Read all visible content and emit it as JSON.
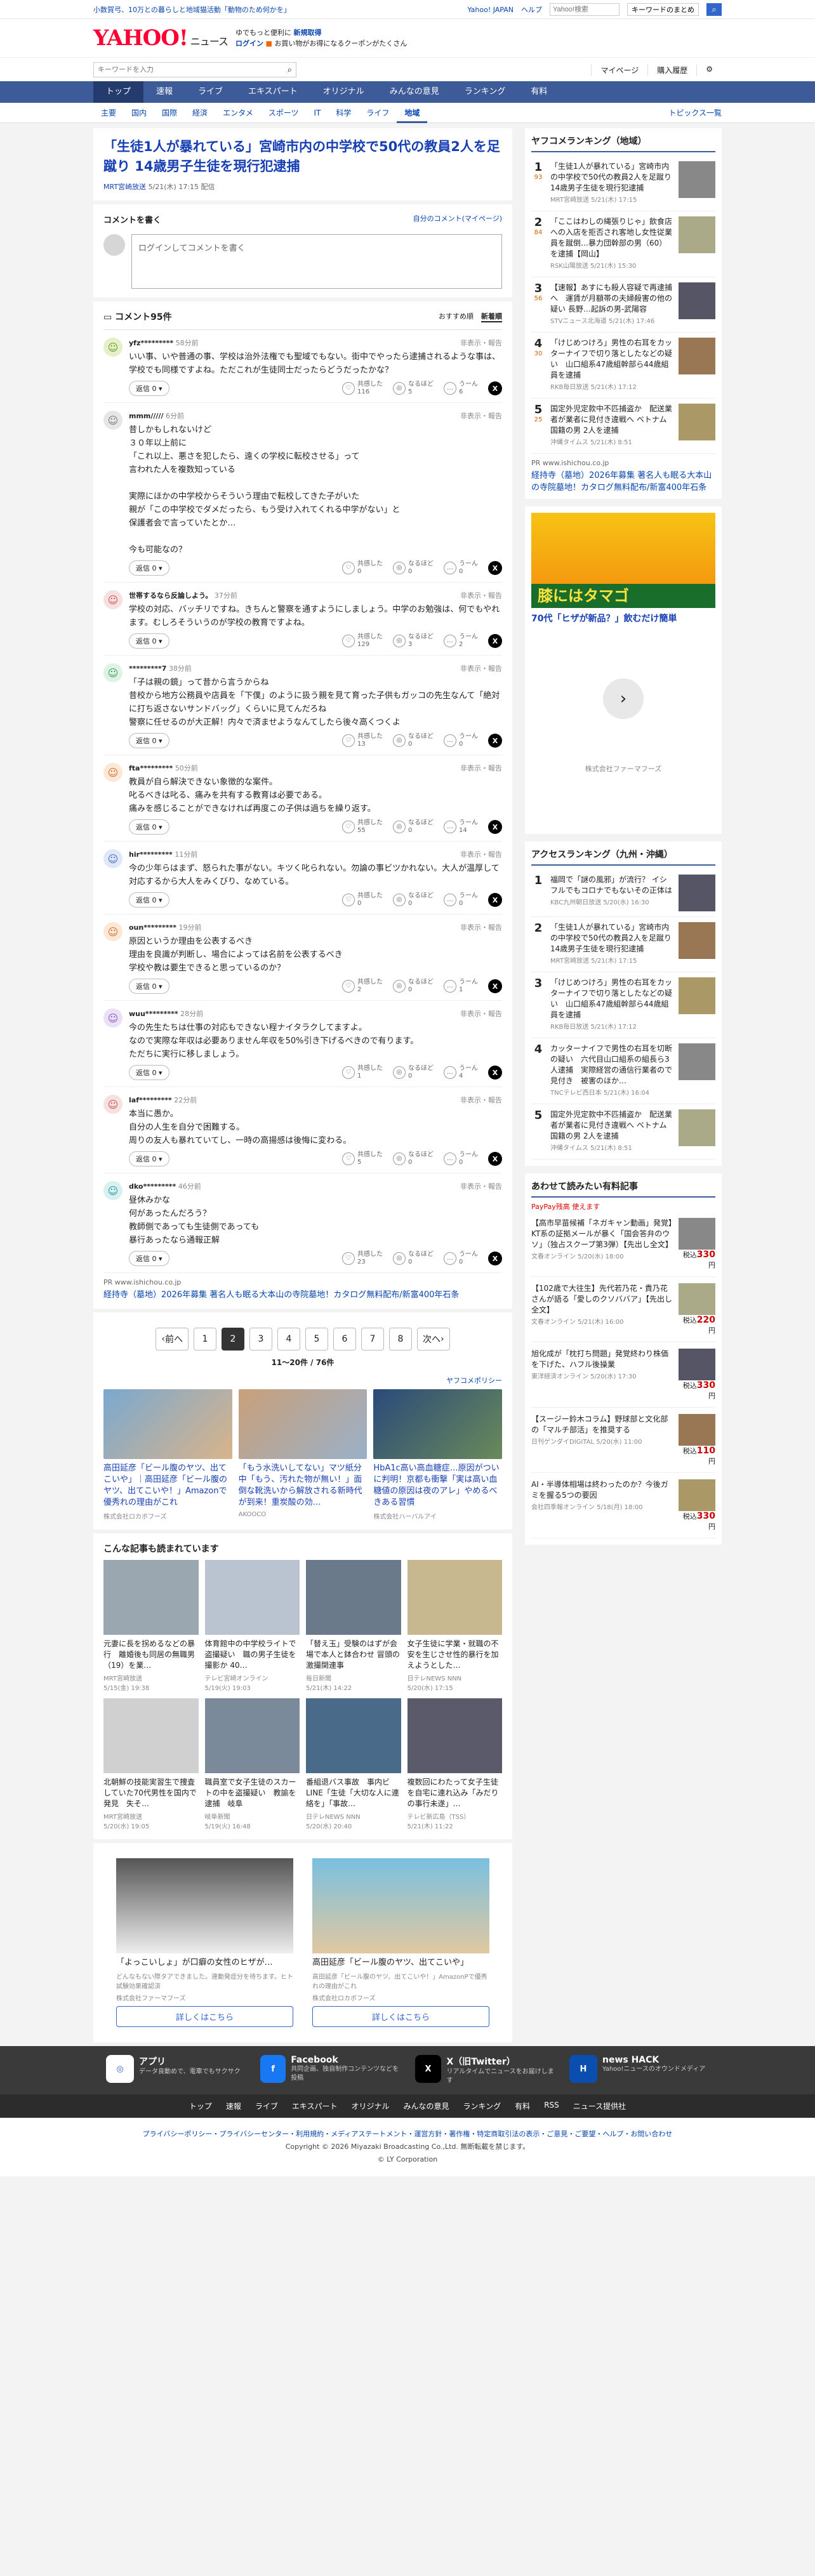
{
  "topbar": {
    "promo": "小数賀弓、10万との暮らしと地域猫活動「動物のため何かを」",
    "yj": "Yahoo! JAPAN",
    "help": "ヘルプ",
    "search_placeholder": "Yahoo!検索",
    "kw_label": "キーワードのまとめ"
  },
  "header": {
    "logo": "YAHOO!",
    "logo_sub": "JAPAN",
    "site": "ニュース",
    "line1a": "ゆでもっと便利に",
    "line1b": "新規取得",
    "line2a": "ログイン",
    "line2b": "お買い物がお得になるクーポンがたくさん"
  },
  "search": {
    "placeholder": "キーワードを入力",
    "mypage": "マイページ",
    "buy": "購入履歴"
  },
  "gnav": [
    "トップ",
    "速報",
    "ライブ",
    "エキスパート",
    "オリジナル",
    "みんなの意見",
    "ランキング",
    "有料"
  ],
  "subnav": [
    "主要",
    "国内",
    "国際",
    "経済",
    "エンタメ",
    "スポーツ",
    "IT",
    "科学",
    "ライフ",
    "地域"
  ],
  "subnav_last": "トピックス一覧",
  "article": {
    "title": "「生徒1人が暴れている」宮崎市内の中学校で50代の教員2人を足蹴り 14歳男子生徒を現行犯逮捕",
    "source": "MRT宮崎放送",
    "date": "5/21(木) 17:15 配信"
  },
  "compose": {
    "heading": "コメントを書く",
    "mine": "自分のコメント(マイページ)",
    "placeholder": "ログインしてコメントを書く"
  },
  "comments_header": {
    "count": "コメント95件",
    "sort1": "おすすめ順",
    "sort2": "新着順"
  },
  "reply_label": "返信",
  "react_labels": [
    "共感した",
    "なるほど",
    "うーん"
  ],
  "report": "非表示・報告",
  "comments": [
    {
      "user": "yfz*********",
      "time": "58分前",
      "text": "いい事、いや普通の事、学校は治外法権でも聖域でもない。街中でやったら逮捕されるような事は、学校でも同様ですよね。ただこれが生徒同士だったらどうだったかな？",
      "reply": "0",
      "r1": "116",
      "r2": "5",
      "r3": "6",
      "bg": "#e6f0c8",
      "fg": "#6a9a1f"
    },
    {
      "user": "mmm/////",
      "time": "6分前",
      "text": "昔しかもしれないけど\n３０年以上前に\n「これ以上、悪さを犯したら、遠くの学校に転校させる」って\n言われた人を複数知っている\n\n実際にほかの中学校からそういう理由で転校してきた子がいた\n親が「この中学校でダメだったら、もう受け入れてくれる中学がない」と\n保護者会で言っていたとか…\n\n今も可能なの？",
      "reply": "0",
      "r1": "0",
      "r2": "0",
      "r3": "0",
      "bg": "#e6e6e6",
      "fg": "#777"
    },
    {
      "user": "世帯するなら反論しよう。",
      "time": "37分前",
      "text": "学校の対応、バッチリですね。きちんと警察を通すようにしましょう。中学のお勉強は、何でもやれます。むしろそういうのが学校の教育ですよね。",
      "reply": "0",
      "r1": "129",
      "r2": "3",
      "r3": "2",
      "bg": "#f7e0e0",
      "fg": "#c55"
    },
    {
      "user": "*********7",
      "time": "38分前",
      "text": "「子は親の鏡」って昔から言うからね\n昔校から地方公務員や店員を「下僕」のように扱う親を見て育った子供もガッコの先生なんて「絶対に打ち返さないサンドバッグ」くらいに見てんだろね\n警察に任せるのが大正解！内々で済ませようなんてしたら後々高くつくよ",
      "reply": "0",
      "r1": "13",
      "r2": "0",
      "r3": "0",
      "bg": "#dff3e4",
      "fg": "#3a9a5a"
    },
    {
      "user": "fta*********",
      "time": "50分前",
      "text": "教員が自ら解決できない象徴的な案件。\n叱るべきは叱る、痛みを共有する教育は必要である。\n痛みを感じることができなければ再度この子供は過ちを繰り返す。",
      "reply": "0",
      "r1": "55",
      "r2": "0",
      "r3": "14",
      "bg": "#fde7d6",
      "fg": "#d0702a"
    },
    {
      "user": "hir*********",
      "time": "11分前",
      "text": "今の少年らはまず、怒られた事がない。キツく叱られない。勿論の事ビツかれない。大人が温厚して対応するから大人をみくびり、なめている。",
      "reply": "0",
      "r1": "0",
      "r2": "0",
      "r3": "0",
      "bg": "#e0e8f8",
      "fg": "#4a6ac0"
    },
    {
      "user": "oun*********",
      "time": "19分前",
      "text": "原因というか理由を公表するべき\n理由を良識が判断し、場合によっては名前を公表するべき\n学校や教は要生できると思っているのか？",
      "reply": "0",
      "r1": "2",
      "r2": "0",
      "r3": "1",
      "bg": "#fde7d6",
      "fg": "#d0702a"
    },
    {
      "user": "wuu*********",
      "time": "28分前",
      "text": "今の先生たちは仕事の対応もできない程ナイタラクしてますよ。\nなので実際な年収は必要ありません年収を50%引き下げるべきので有ります。\nただちに実行に移しましょう。",
      "reply": "0",
      "r1": "1",
      "r2": "0",
      "r3": "4",
      "bg": "#ece0f6",
      "fg": "#8a5ac0"
    },
    {
      "user": "laf*********",
      "time": "22分前",
      "text": "本当に愚か。\n自分の人生を自分で困難する。\n周りの友人も暴れていてし、一時の高揚感は後悔に変わる。",
      "reply": "0",
      "r1": "5",
      "r2": "0",
      "r3": "0",
      "bg": "#f7e0e0",
      "fg": "#c55"
    },
    {
      "user": "dko*********",
      "time": "46分前",
      "text": "昼休みかな\n何があったんだろう？\n教師側であっても生徒側であっても\n暴行あったなら通報正解",
      "reply": "0",
      "r1": "23",
      "r2": "0",
      "r3": "0",
      "bg": "#d8f0f0",
      "fg": "#2a9a9a"
    }
  ],
  "pr_inline": {
    "domain": "www.ishichou.co.jp",
    "text": "経持寺（墓地）2026年募集 著名人も眠る大本山の寺院墓地！カタログ無料配布/新富400年石条"
  },
  "pager": {
    "prev": "前へ",
    "next": "次へ",
    "pages": [
      "1",
      "2",
      "3",
      "4",
      "5",
      "6",
      "7",
      "8"
    ],
    "current": "2",
    "info": "11～20件 / 76件"
  },
  "ads_policy": "ヤフコメポリシー",
  "ad_row": [
    {
      "title": "高田延彦「ビール腹のヤツ、出てこいや」｜高田延彦「ビール腹のヤツ、出てこいや！」Amazonで優秀れの理由がこれ",
      "src": "株式会社ロカボフーズ",
      "c1": "#7aa8d0",
      "c2": "#d9b48a"
    },
    {
      "title": "「もう水洗いしてない」マツ紙分中「もう、汚れた物が無い！」面倒な靴洗いから解放される新時代が到来！重炭酸の効…",
      "src": "AKOOCO",
      "c1": "#c9a07a",
      "c2": "#9ab0c8"
    },
    {
      "title": "HbA1c高い高血糖症…原因がついに判明！京都も衝撃「実は高い血糖値の原因は夜のアレ」やめるべきある習慣",
      "src": "株式会社ハーバルアイ",
      "c1": "#2a4a7a",
      "c2": "#6a8a5a"
    }
  ],
  "related": {
    "title": "こんな記事も読まれています",
    "items": [
      {
        "t": "元妻に長を拐めるなどの暴行　離婚後も同居の無職男（19）を業…",
        "s": "MRT宮崎放送",
        "d": "5/15(金) 19:38"
      },
      {
        "t": "体育館中の中学校ライトで盗撮疑い　職の男子生徒を撮影か 40…",
        "s": "テレビ宮崎オンライン",
        "d": "5/19(火) 19:03"
      },
      {
        "t": "「替え玉」受験のはずが会場で本人と鉢合わせ 冒頭の激撮関連事",
        "s": "毎日新聞",
        "d": "5/21(木) 14:22"
      },
      {
        "t": "女子生徒に学業・就職の不安を生じさせ性的暴行を加えようとした…",
        "s": "日テレNEWS NNN",
        "d": "5/20(水) 17:15"
      },
      {
        "t": "北朝鮮の技能実習生で捜査していた70代男性を国内で発見　失そ…",
        "s": "MRT宮崎放送",
        "d": "5/20(水) 19:05"
      },
      {
        "t": "職員室で女子生徒のスカートの中を盗撮疑い　教諭を逮捕　岐阜",
        "s": "岐阜新聞",
        "d": "5/19(火) 16:48"
      },
      {
        "t": "番組退バス事故　事内ビLINE「生徒「大切な人に連絡を」「事故…",
        "s": "日テレNEWS NNN",
        "d": "5/20(水) 20:40"
      },
      {
        "t": "複数回にわたって女子生徒を自宅に連れ込み「みだりの事行未遂」…",
        "s": "テレビ新広島（TSS）",
        "d": "5/21(木) 11:22"
      }
    ]
  },
  "bottom_ads": [
    {
      "title": "「よっこいしょ」が口癖の女性のヒザが…",
      "sub": "どんなもない際タアできました。連動発症分を待ちます。ヒト試験効果確認済",
      "src": "株式会社ファーマフーズ",
      "cta": "詳しくはこちら"
    },
    {
      "title": "高田延彦「ビール腹のヤツ、出てこいや」",
      "sub": "高田延彦「ビール腹のヤツ、出てこいや！」AmazonPで優秀れの理由がこれ",
      "src": "株式会社ロカボフーズ",
      "cta": "詳しくはこちら"
    }
  ],
  "ranking": {
    "title": "ヤフコメランキング（地域）",
    "items": [
      {
        "n": "1",
        "c": "93",
        "t": "「生徒1人が暴れている」宮崎市内の中学校で50代の教員2人を足蹴り 14歳男子生徒を現行犯逮捕",
        "s": "MRT宮崎放送 5/21(木) 17:15"
      },
      {
        "n": "2",
        "c": "84",
        "t": "「ここはわしの縄張りじゃ」飲食店への入店を拒否され客地し女性従業員を蹴倒…暴力団幹部の男（60）を逮捕【岡山】",
        "s": "RSK山陽放送 5/21(木) 15:30"
      },
      {
        "n": "3",
        "c": "56",
        "t": "【速報】あすにも殺人容疑で再逮捕へ　運賃が月額帯の夫婦殺害の他の疑い 長野…起訴の男-武陽容",
        "s": "STVニュース北海道 5/21(木) 17:46"
      },
      {
        "n": "4",
        "c": "30",
        "t": "「けじめつけろ」男性の右耳をカッターナイフで切り落としたなどの疑い　山口組系47歳組幹部ら44歳組員を逮捕",
        "s": "RKB毎日放送 5/21(木) 17:12"
      },
      {
        "n": "5",
        "c": "25",
        "t": "国定外児定款中不匹捕盗か　配送業者が業者に見付き違戦へ ベトナム国籍の男 2人を逮捕",
        "s": "沖縄タイムス 5/21(木) 8:51"
      }
    ]
  },
  "pr_right": {
    "domain": "www.ishichou.co.jp",
    "text": "経持寺（墓地）2026年募集 著名人も眠る大本山の寺院墓地！カタログ無料配布/新富400年石条"
  },
  "egg_ad": {
    "banner": "膝にはタマゴ",
    "headline": "70代「ヒザが新品？」飲むだけ簡単",
    "company": "株式会社ファーマフーズ"
  },
  "access": {
    "title": "アクセスランキング（九州・沖縄）",
    "items": [
      {
        "n": "1",
        "t": "福岡で「謎の風邪」が流行？ イシフルでもコロナでもないその正体は",
        "s": "KBC九州朝日放送 5/20(水) 16:30"
      },
      {
        "n": "2",
        "t": "「生徒1人が暴れている」宮崎市内の中学校で50代の教員2人を足蹴り 14歳男子生徒を現行犯逮捕",
        "s": "MRT宮崎放送 5/21(木) 17:15"
      },
      {
        "n": "3",
        "t": "「けじめつけろ」男性の右耳をカッターナイフで切り落としたなどの疑い　山口組系47歳組幹部ら44歳組員を逮捕",
        "s": "RKB毎日放送 5/21(木) 17:12"
      },
      {
        "n": "4",
        "t": "カッターナイフで男性の右耳を切断の疑い　六代目山口組系の組長ら3人逮捕　実際経営の通信行業者ので見付き　被害のほか…",
        "s": "TNCテレビ西日本 5/21(木) 16:04"
      },
      {
        "n": "5",
        "t": "国定外児定款中不匹捕盗か　配送業者が業者に見付き違戦へ ベトナム国籍の男 2人を逮捕",
        "s": "沖縄タイムス 5/21(木) 8:51"
      }
    ]
  },
  "paid": {
    "title": "あわせて読みたい有料記事",
    "badge": "PayPay残高 使えます",
    "items": [
      {
        "t": "【高市早苗候補「ネガキャン動画」発覚】KT系の証拠メールが暴く「国会答弁のウソ」（独占スクープ第3弾）【先出し全文】",
        "s": "文春オンライン 5/20(水) 18:00",
        "p": "330"
      },
      {
        "t": "【102歳で大往生】先代若乃花・貴乃花さんが語る「愛しのクソババア」【先出し全文】",
        "s": "文春オンライン 5/21(木) 16:00",
        "p": "220"
      },
      {
        "t": "旭化成が「枕打ち問題」発覚終わり株価を下げた、ハフル後操業",
        "s": "東洋経済オンライン 5/20(水) 17:30",
        "p": "330"
      },
      {
        "t": "【スージー鈴木コラム】野球部と文化部の「マルチ部活」を推奨する",
        "s": "日刊ゲンダイDIGITAL 5/20(水) 11:00",
        "p": "110"
      },
      {
        "t": "AI・半導体相場は終わったのか？今後ガミを握る5つの要因",
        "s": "会社四季報オンライン 5/18(月) 18:00",
        "p": "330"
      }
    ],
    "price_label": "税込"
  },
  "footer": {
    "apps": [
      {
        "name": "アプリ",
        "desc": "データ良動めで、電車でもサクサク"
      },
      {
        "name": "Facebook",
        "desc": "共同企画、独自制作コンテンツなどを投稿"
      },
      {
        "name": "X（旧Twitter）",
        "desc": "リアルタイムでニュースをお届けします"
      },
      {
        "name": "news HACK",
        "desc": "Yahoo!ニュースのオウンドメディア"
      }
    ],
    "nav": [
      "トップ",
      "速報",
      "ライブ",
      "エキスパート",
      "オリジナル",
      "みんなの意見",
      "ランキング",
      "有料",
      "RSS",
      "ニュース提供社"
    ],
    "legal1": "プライバシーポリシー・プライバシーセンター・利用規約・メディアステートメント・運営方針・著作権・特定商取引法の表示・ご意見・ご要望・ヘルプ・お問い合わせ",
    "copyright": "Copyright © 2026 Miyazaki Broadcasting Co.,Ltd. 無断転載を禁じます。",
    "ly": "© LY Corporation"
  }
}
